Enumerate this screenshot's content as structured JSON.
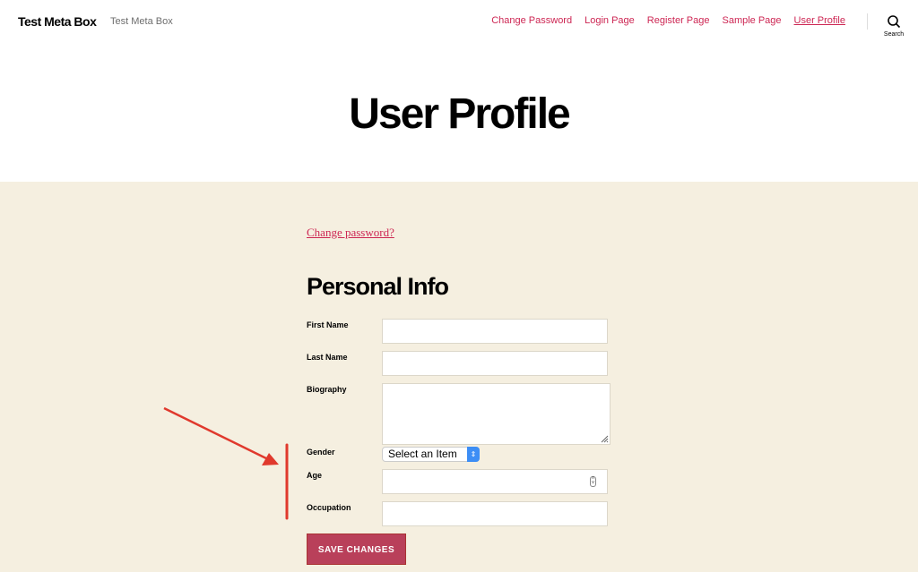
{
  "header": {
    "site_title": "Test Meta Box",
    "tagline": "Test Meta Box",
    "nav": [
      "Change Password",
      "Login Page",
      "Register Page",
      "Sample Page",
      "User Profile"
    ],
    "search_label": "Search"
  },
  "page_title": "User Profile",
  "form": {
    "change_password_link": "Change password?",
    "section_title": "Personal Info",
    "fields": {
      "first_name": "First Name",
      "last_name": "Last Name",
      "biography": "Biography",
      "gender": "Gender",
      "age": "Age",
      "occupation": "Occupation"
    },
    "gender_selected": "Select an Item",
    "save_label": "SAVE CHANGES"
  },
  "colors": {
    "accent": "#cd2653",
    "background": "#f5efe0",
    "button": "#b9405a",
    "annotation": "#e0392d"
  }
}
